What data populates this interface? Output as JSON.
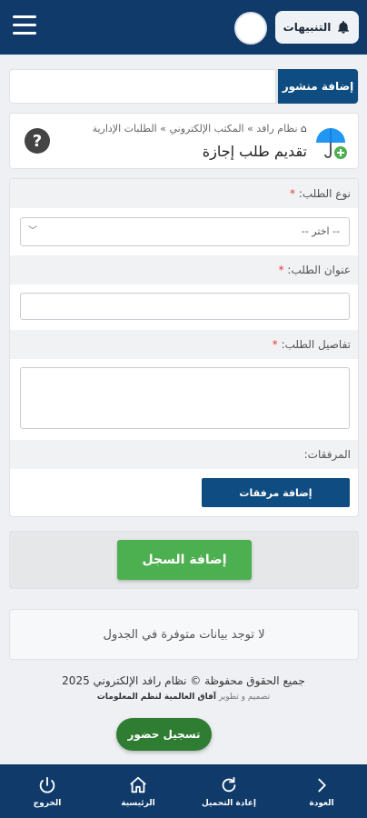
{
  "header": {
    "notifications_label": "التنبيهات"
  },
  "add_post": {
    "label": "إضافة منشور"
  },
  "breadcrumb": {
    "items": [
      "نظام رافد",
      "المكتب الإلكتروني",
      "الطلبات الإدارية"
    ],
    "separator": "»"
  },
  "page": {
    "title": "تقديم طلب إجازة"
  },
  "form": {
    "type_label": "نوع الطلب:",
    "type_placeholder": "-- اختر --",
    "title_label": "عنوان الطلب:",
    "details_label": "تفاصيل الطلب:",
    "attachments_label": "المرفقات:",
    "attach_button": "إضافة مرفقات",
    "required_mark": "*"
  },
  "actions": {
    "save_label": "إضافة السجل"
  },
  "table": {
    "empty_message": "لا توجد بيانات متوفرة في الجدول"
  },
  "footer": {
    "copyright": "جميع الحقوق محفوظة © نظام رافد الإلكتروني 2025",
    "dev_prefix": "تصميم و تطوير",
    "dev_company": "آفاق العالمية لنظم المعلومات"
  },
  "attendance": {
    "label": "تسجيل حضور"
  },
  "bottom_nav": {
    "back": "العودة",
    "reload": "إعادة التحميل",
    "home": "الرئيسية",
    "logout": "الخروج"
  },
  "colors": {
    "primary": "#0f3a69",
    "accent_blue": "#0f4c81",
    "success": "#4caf50",
    "attendance": "#2e7d32",
    "required": "#e53935"
  }
}
